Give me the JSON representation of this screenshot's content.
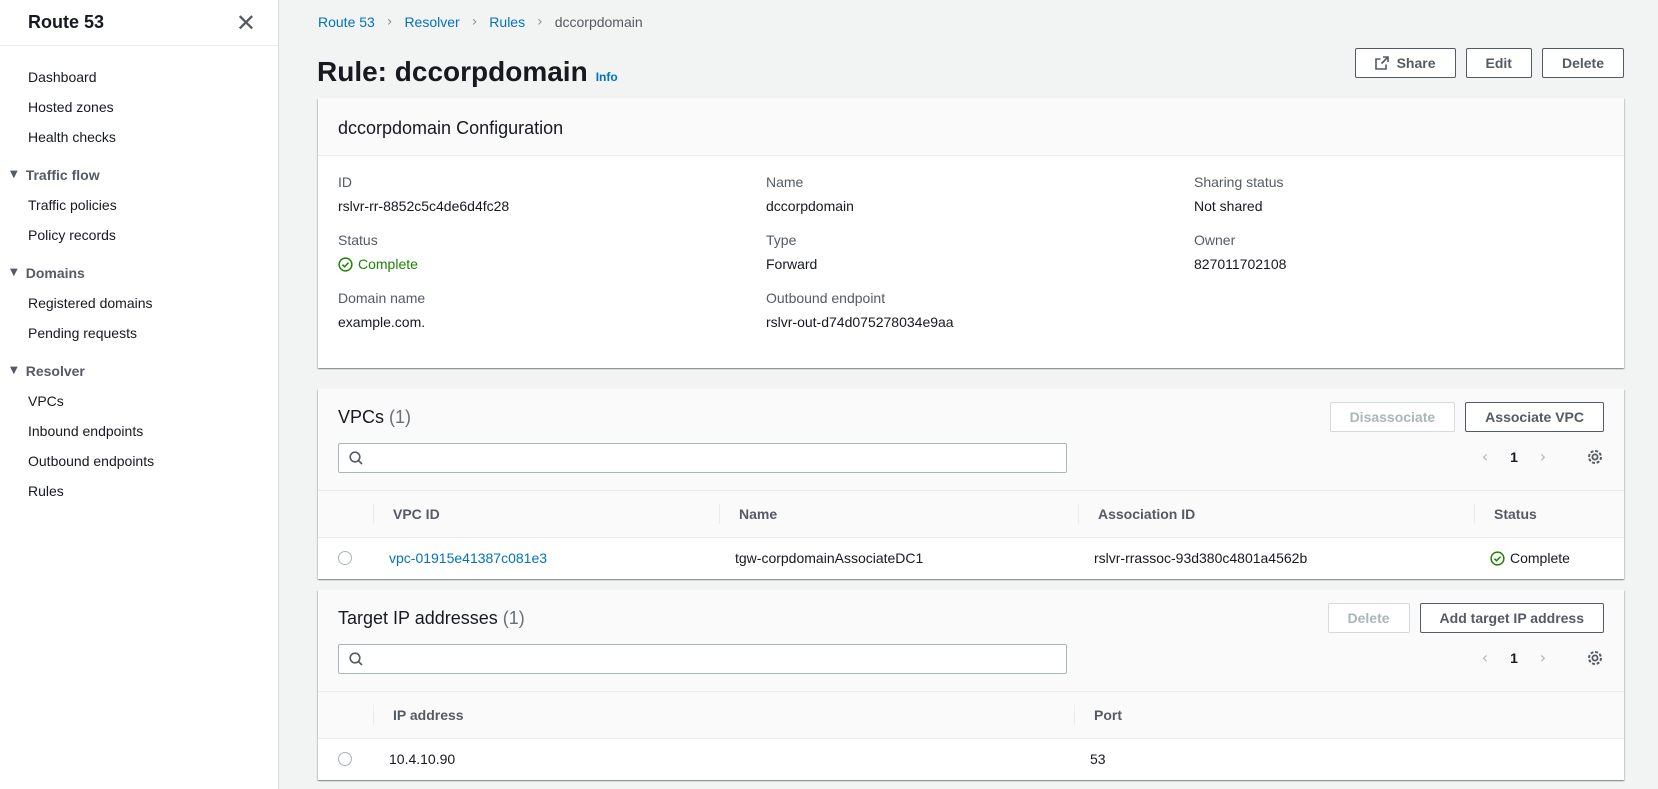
{
  "sidebar": {
    "title": "Route 53",
    "items": [
      {
        "label": "Dashboard"
      },
      {
        "label": "Hosted zones"
      },
      {
        "label": "Health checks"
      }
    ],
    "sections": [
      {
        "label": "Traffic flow",
        "items": [
          {
            "label": "Traffic policies"
          },
          {
            "label": "Policy records"
          }
        ]
      },
      {
        "label": "Domains",
        "items": [
          {
            "label": "Registered domains"
          },
          {
            "label": "Pending requests"
          }
        ]
      },
      {
        "label": "Resolver",
        "items": [
          {
            "label": "VPCs"
          },
          {
            "label": "Inbound endpoints"
          },
          {
            "label": "Outbound endpoints"
          },
          {
            "label": "Rules"
          }
        ]
      }
    ]
  },
  "breadcrumb": [
    "Route 53",
    "Resolver",
    "Rules",
    "dccorpdomain"
  ],
  "page": {
    "title": "Rule: dccorpdomain",
    "info": "Info",
    "buttons": {
      "share": "Share",
      "edit": "Edit",
      "delete": "Delete"
    }
  },
  "config": {
    "title": "dccorpdomain Configuration",
    "fields": {
      "id": {
        "label": "ID",
        "value": "rslvr-rr-8852c5c4de6d4fc28"
      },
      "name": {
        "label": "Name",
        "value": "dccorpdomain"
      },
      "sharing": {
        "label": "Sharing status",
        "value": "Not shared"
      },
      "status": {
        "label": "Status",
        "value": "Complete"
      },
      "type": {
        "label": "Type",
        "value": "Forward"
      },
      "owner": {
        "label": "Owner",
        "value": "827011702108"
      },
      "domain": {
        "label": "Domain name",
        "value": "example.com."
      },
      "outbound": {
        "label": "Outbound endpoint",
        "value": "rslvr-out-d74d075278034e9aa"
      }
    }
  },
  "vpcs": {
    "title": "VPCs",
    "count": "(1)",
    "disassociate": "Disassociate",
    "associate": "Associate VPC",
    "page": "1",
    "columns": {
      "vpc_id": "VPC ID",
      "name": "Name",
      "association_id": "Association ID",
      "status": "Status"
    },
    "rows": [
      {
        "vpc_id": "vpc-01915e41387c081e3",
        "name": "tgw-corpdomainAssociateDC1",
        "association_id": "rslvr-rrassoc-93d380c4801a4562b",
        "status": "Complete"
      }
    ]
  },
  "targets": {
    "title": "Target IP addresses",
    "count": "(1)",
    "delete": "Delete",
    "add": "Add target IP address",
    "page": "1",
    "columns": {
      "ip": "IP address",
      "port": "Port"
    },
    "rows": [
      {
        "ip": "10.4.10.90",
        "port": "53"
      }
    ]
  },
  "colors": {
    "link": "#0073bb",
    "success": "#1d8102",
    "text": "#16191f",
    "muted": "#545b64"
  }
}
